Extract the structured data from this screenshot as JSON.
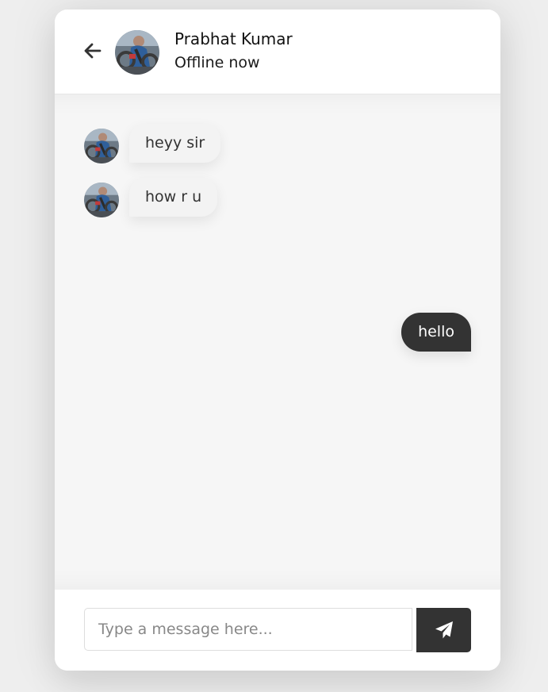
{
  "header": {
    "back_icon": "arrow-left-icon",
    "name": "Prabhat Kumar",
    "status": "Offline now"
  },
  "messages": [
    {
      "direction": "incoming",
      "text": "heyy sir"
    },
    {
      "direction": "incoming",
      "text": "how r u"
    },
    {
      "direction": "outgoing",
      "text": "hello"
    }
  ],
  "composer": {
    "placeholder": "Type a message here...",
    "send_icon": "paper-plane-icon"
  },
  "colors": {
    "page_background": "#eeeeee",
    "chat_background": "#f6f6f6",
    "outgoing_bubble": "#333333",
    "incoming_bubble": "#f3f3f3",
    "send_button": "#333333"
  }
}
